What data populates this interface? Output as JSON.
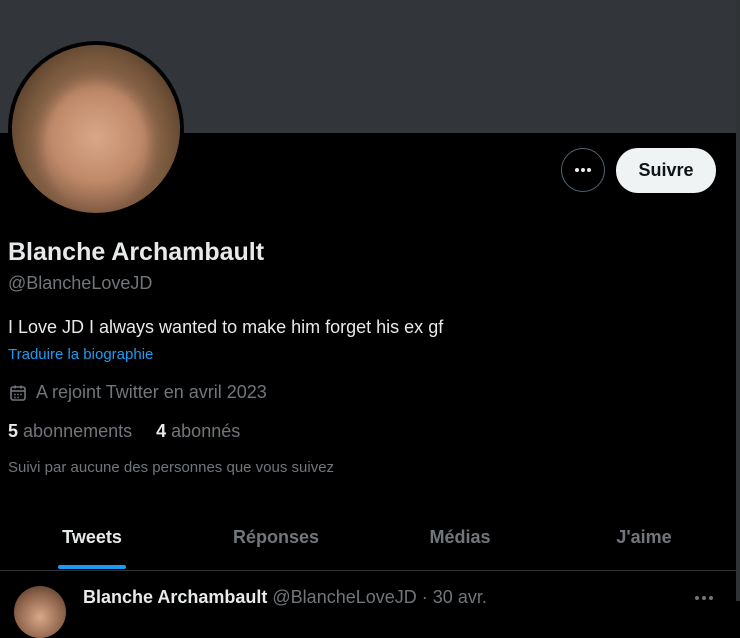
{
  "profile": {
    "display_name": "Blanche Archambault",
    "handle": "@BlancheLoveJD",
    "bio": "I Love JD I always wanted to make him forget his ex gf",
    "translate_link": "Traduire la biographie",
    "joined": "A rejoint Twitter en avril 2023",
    "following_count": "5",
    "following_label": "abonnements",
    "followers_count": "4",
    "followers_label": "abonnés",
    "followed_by": "Suivi par aucune des personnes que vous suivez"
  },
  "actions": {
    "follow_label": "Suivre",
    "more_icon": "more-horizontal-icon"
  },
  "tabs": [
    {
      "label": "Tweets",
      "active": true
    },
    {
      "label": "Réponses",
      "active": false
    },
    {
      "label": "Médias",
      "active": false
    },
    {
      "label": "J'aime",
      "active": false
    }
  ],
  "tweet": {
    "name": "Blanche Archambault",
    "handle": "@BlancheLoveJD",
    "separator": "·",
    "date": "30 avr."
  },
  "colors": {
    "accent": "#1d9bf0",
    "background": "#000000",
    "banner": "#32363b"
  }
}
